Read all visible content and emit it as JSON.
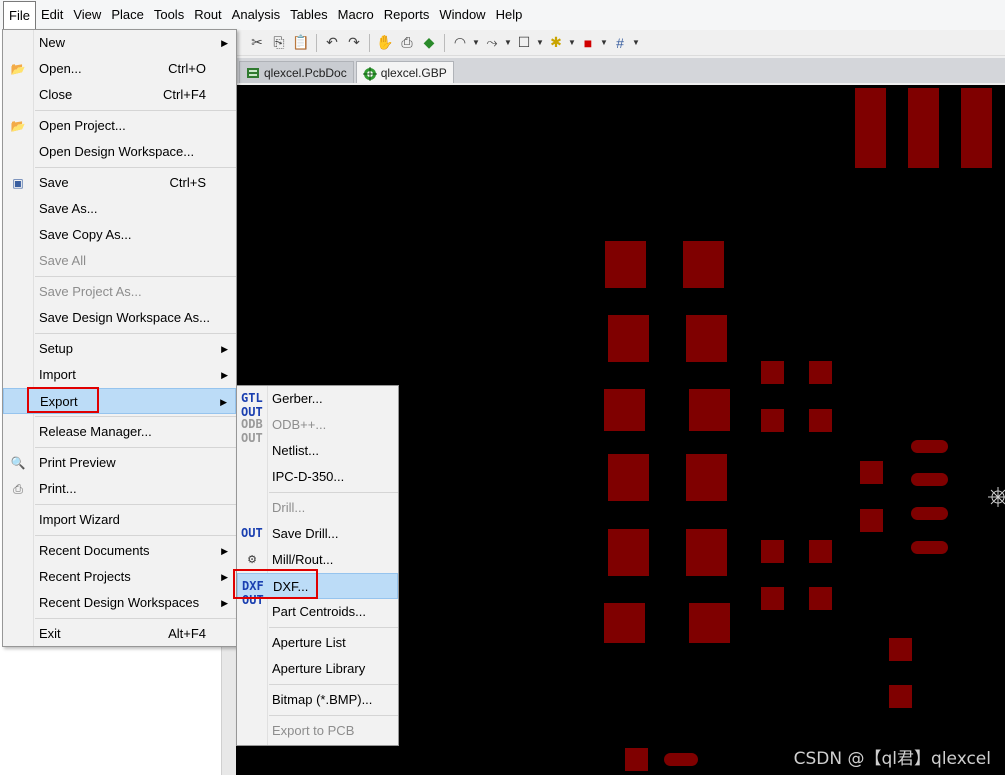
{
  "menubar": [
    "File",
    "Edit",
    "View",
    "Place",
    "Tools",
    "Rout",
    "Analysis",
    "Tables",
    "Macro",
    "Reports",
    "Window",
    "Help"
  ],
  "tabs": [
    {
      "label": "qlexcel.PcbDoc",
      "active": false
    },
    {
      "label": "qlexcel.GBP",
      "active": true
    }
  ],
  "file_menu": {
    "new": {
      "label": "New"
    },
    "open": {
      "label": "Open...",
      "shortcut": "Ctrl+O"
    },
    "close": {
      "label": "Close",
      "shortcut": "Ctrl+F4"
    },
    "open_project": {
      "label": "Open Project..."
    },
    "open_workspace": {
      "label": "Open Design Workspace..."
    },
    "save": {
      "label": "Save",
      "shortcut": "Ctrl+S"
    },
    "save_as": {
      "label": "Save As..."
    },
    "save_copy_as": {
      "label": "Save Copy As..."
    },
    "save_all": {
      "label": "Save All"
    },
    "save_project_as": {
      "label": "Save Project As..."
    },
    "save_workspace_as": {
      "label": "Save Design Workspace As..."
    },
    "setup": {
      "label": "Setup"
    },
    "import": {
      "label": "Import"
    },
    "export": {
      "label": "Export"
    },
    "release_manager": {
      "label": "Release Manager..."
    },
    "print_preview": {
      "label": "Print Preview"
    },
    "print": {
      "label": "Print..."
    },
    "import_wizard": {
      "label": "Import Wizard"
    },
    "recent_documents": {
      "label": "Recent Documents"
    },
    "recent_projects": {
      "label": "Recent Projects"
    },
    "recent_workspaces": {
      "label": "Recent Design Workspaces"
    },
    "exit": {
      "label": "Exit",
      "shortcut": "Alt+F4"
    }
  },
  "export_menu": {
    "gerber": {
      "label": "Gerber..."
    },
    "odb": {
      "label": "ODB++..."
    },
    "netlist": {
      "label": "Netlist..."
    },
    "ipc": {
      "label": "IPC-D-350..."
    },
    "drill": {
      "label": "Drill..."
    },
    "save_drill": {
      "label": "Save Drill..."
    },
    "mill_rout": {
      "label": "Mill/Rout..."
    },
    "dxf": {
      "label": "DXF..."
    },
    "part_centroids": {
      "label": "Part Centroids..."
    },
    "aperture_list": {
      "label": "Aperture List"
    },
    "aperture_library": {
      "label": "Aperture Library"
    },
    "bitmap": {
      "label": "Bitmap (*.BMP)..."
    },
    "export_to_pcb": {
      "label": "Export to PCB"
    }
  },
  "icons": {
    "gerber": "GTL OUT",
    "odb": "ODB OUT",
    "dxf": "DXF OUT",
    "drill": "OUT"
  },
  "colors": {
    "pad": "#7f0000",
    "canvas": "#000000",
    "highlight": "#bcdcf7",
    "annotation": "#e00000"
  },
  "watermark": "CSDN @【ql君】qlexcel"
}
